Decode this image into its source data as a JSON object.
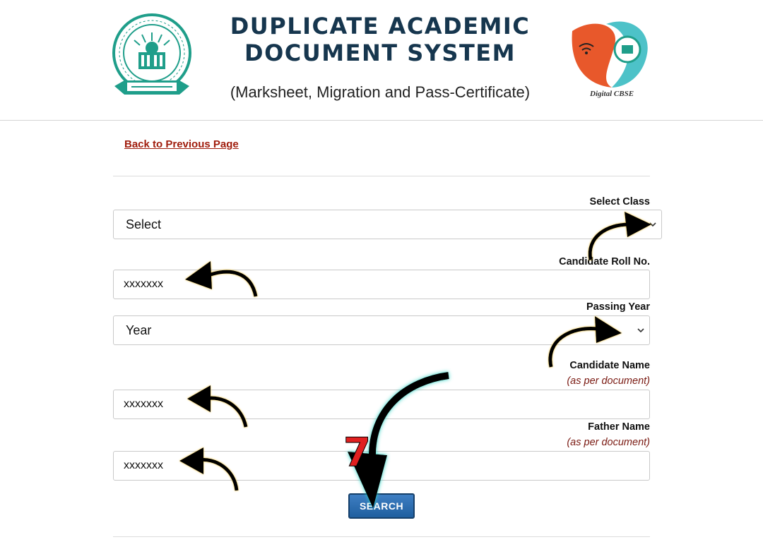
{
  "header": {
    "title": "DUPLICATE ACADEMIC\nDOCUMENT SYSTEM",
    "subtitle": "(Marksheet, Migration and Pass-Certificate)",
    "left_logo_icon": "cbse-emblem-icon",
    "right_logo_icon": "digital-cbse-logo-icon",
    "right_logo_text": "Digital CBSE"
  },
  "nav": {
    "back_link": "Back to Previous Page"
  },
  "form": {
    "select_class": {
      "label": "Select Class",
      "value": "Select"
    },
    "roll_no": {
      "label": "Candidate Roll No.",
      "value": "xxxxxxx"
    },
    "passing_year": {
      "label": "Passing Year",
      "value": "Year"
    },
    "candidate_name": {
      "label": "Candidate Name",
      "hint": "(as per document)",
      "value": "xxxxxxx"
    },
    "father_name": {
      "label": "Father Name",
      "hint": "(as per document)",
      "value": "xxxxxxx"
    },
    "search_button": "SEARCH"
  },
  "annotations": {
    "step_number": "7",
    "arrow_color": "#000000",
    "step_color": "#e02020",
    "glow_color": "#29d3c4"
  },
  "colors": {
    "title": "#16364e",
    "link": "#a01d0d",
    "hint": "#7a1a12",
    "button": "#2b6cb0",
    "emblem": "#1f9e8a"
  }
}
